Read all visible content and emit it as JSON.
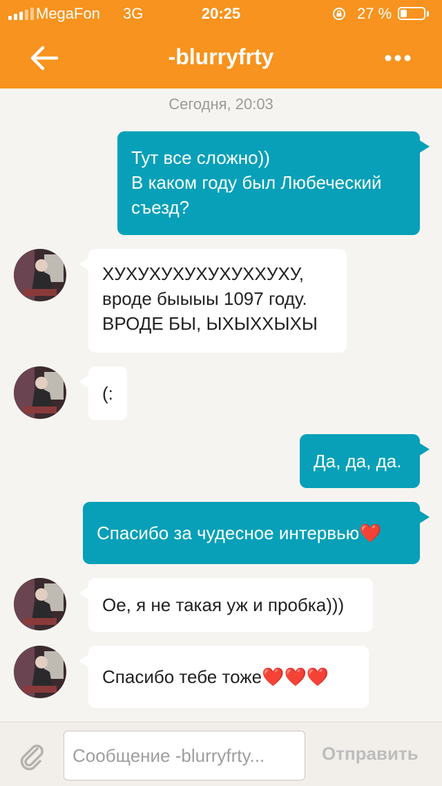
{
  "status_bar": {
    "carrier": "MegaFon",
    "network": "3G",
    "time": "20:25",
    "battery_percent": "27 %",
    "battery_level": 0.27
  },
  "header": {
    "title": "-blurryfrty",
    "back_icon": "arrow-left-icon",
    "more_icon": "more-horizontal-icon"
  },
  "date_separator": "Сегодня, 20:03",
  "messages": [
    {
      "direction": "outgoing",
      "lines": [
        "Тут все сложно))",
        "В каком году был Любеческий",
        "съезд?"
      ]
    },
    {
      "direction": "incoming",
      "lines": [
        "ХУХУХУХУХУХУХХУХУ,",
        "вроде быыыы 1097 году.",
        "ВРОДЕ БЫ, ЫХЫХХЫХЫ"
      ]
    },
    {
      "direction": "incoming",
      "lines": [
        "(:"
      ]
    },
    {
      "direction": "outgoing",
      "lines": [
        "Да, да, да."
      ]
    },
    {
      "direction": "outgoing",
      "lines": [
        "Спасибо за чудесное интервью❤️"
      ]
    },
    {
      "direction": "incoming",
      "lines": [
        "Ое, я не такая уж и пробка)))"
      ]
    },
    {
      "direction": "incoming",
      "lines": [
        "Спасибо тебе тоже❤️❤️❤️"
      ]
    }
  ],
  "composer": {
    "placeholder": "Сообщение -blurryfrty...",
    "value": "",
    "send_label": "Отправить",
    "attach_icon": "paperclip-icon"
  },
  "colors": {
    "header": "#f7931e",
    "outgoing_bubble": "#07a0b8",
    "incoming_bubble": "#ffffff",
    "background": "#f6f4f0"
  }
}
